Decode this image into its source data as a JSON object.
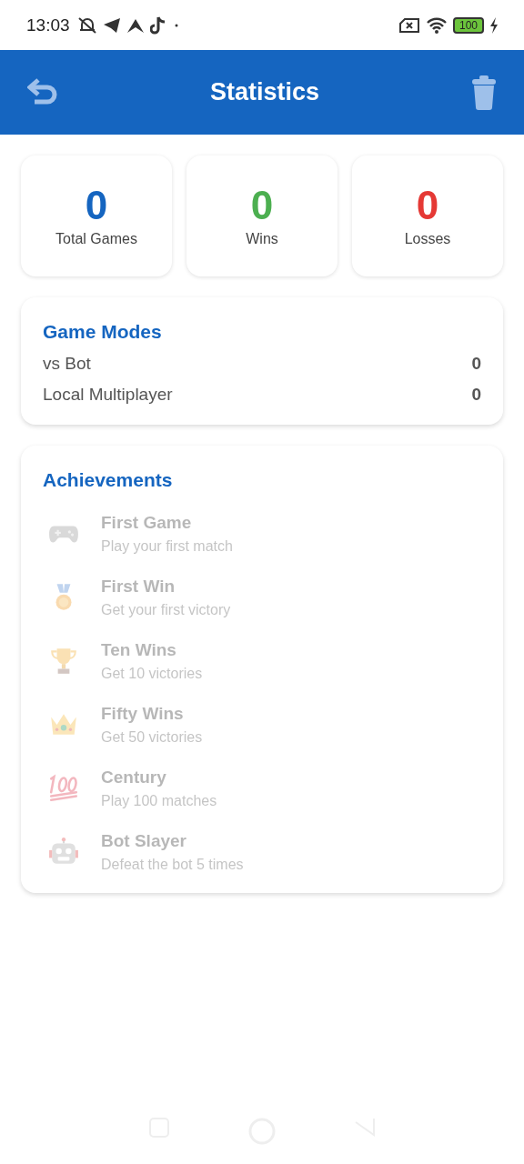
{
  "status_bar": {
    "time": "13:03",
    "battery": "100"
  },
  "app_bar": {
    "title": "Statistics"
  },
  "stats": [
    {
      "value": "0",
      "label": "Total Games",
      "color": "#1565c0"
    },
    {
      "value": "0",
      "label": "Wins",
      "color": "#4caf50"
    },
    {
      "value": "0",
      "label": "Losses",
      "color": "#e53935"
    }
  ],
  "game_modes": {
    "title": "Game Modes",
    "rows": [
      {
        "label": "vs Bot",
        "value": "0"
      },
      {
        "label": "Local Multiplayer",
        "value": "0"
      }
    ]
  },
  "achievements": {
    "title": "Achievements",
    "items": [
      {
        "kind": "gamepad",
        "title": "First Game",
        "description": "Play your first match",
        "unlocked": false
      },
      {
        "kind": "medal",
        "title": "First Win",
        "description": "Get your first victory",
        "unlocked": false
      },
      {
        "kind": "trophy",
        "title": "Ten Wins",
        "description": "Get 10 victories",
        "unlocked": false
      },
      {
        "kind": "crown",
        "title": "Fifty Wins",
        "description": "Get 50 victories",
        "unlocked": false
      },
      {
        "kind": "hundred",
        "title": "Century",
        "description": "Play 100 matches",
        "unlocked": false
      },
      {
        "kind": "robot",
        "title": "Bot Slayer",
        "description": "Defeat the bot 5 times",
        "unlocked": false
      }
    ]
  }
}
